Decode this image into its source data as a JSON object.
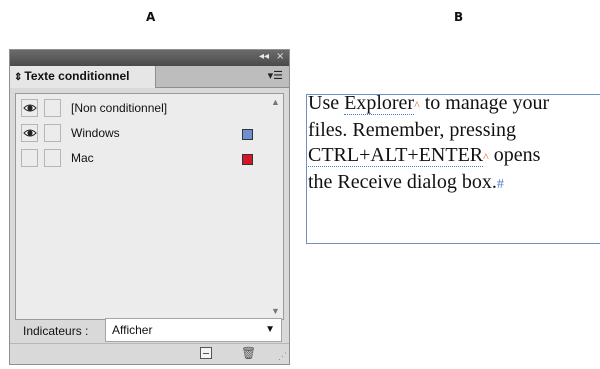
{
  "figure": {
    "label_a": "A",
    "label_b": "B"
  },
  "panel": {
    "collapse_glyph": "◂◂",
    "close_glyph": "×",
    "tab_arrows": "⇕",
    "tab_title": "Texte conditionnel",
    "menu_glyph": "▾☰",
    "conditions": [
      {
        "name": "[Non conditionnel]",
        "visible": true,
        "swatch": null
      },
      {
        "name": "Windows",
        "visible": true,
        "swatch": "#6f8fce"
      },
      {
        "name": "Mac",
        "visible": false,
        "swatch": "#d5162a"
      }
    ],
    "indicators_label": "Indicateurs :",
    "indicators_value": "Afficher"
  },
  "frame_text": {
    "line1_a": "Use ",
    "line1_word": "Explorer",
    "line1_b": " to manage your",
    "line2": "files. Remember, pressing",
    "line3_word": "CTRL+ALT+ENTER",
    "line3_b": " opens",
    "line4": "the Receive dialog box.",
    "end_mark": "#",
    "condition_marker": "^"
  },
  "colors": {
    "windows": "#6f8fce",
    "mac": "#d5162a",
    "frame_border": "#6f8fc7",
    "marker": "#e0622a"
  }
}
